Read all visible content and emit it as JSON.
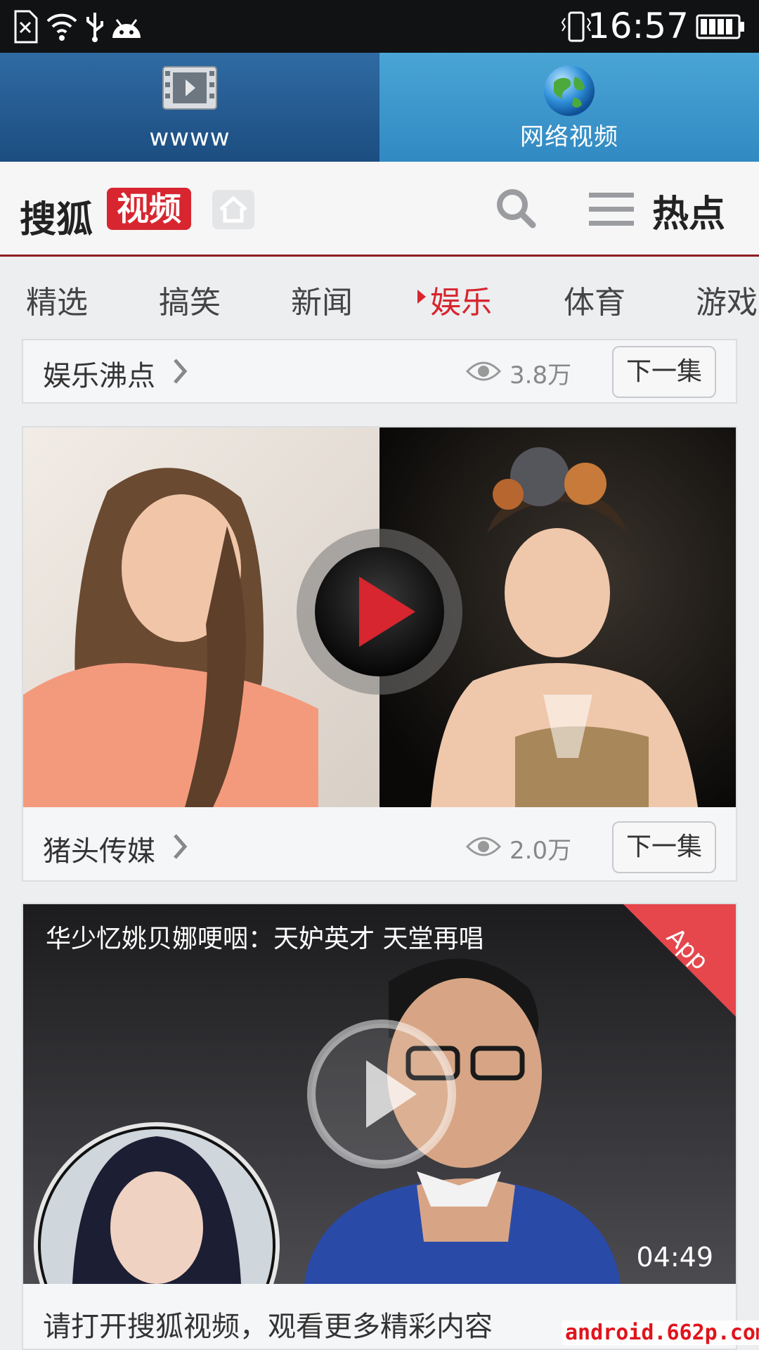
{
  "status_bar": {
    "time": "16:57"
  },
  "top_tabs": [
    {
      "label": "wwww",
      "icon": "film-icon"
    },
    {
      "label": "网络视频",
      "icon": "globe-icon"
    }
  ],
  "header": {
    "logo_text": "搜狐",
    "logo_badge": "视频",
    "hot_label": "热点",
    "brand_color": "#d7262f"
  },
  "categories": [
    "精选",
    "搞笑",
    "新闻",
    "娱乐",
    "体育",
    "游戏"
  ],
  "active_category": "娱乐",
  "cards": [
    {
      "source": "娱乐沸点",
      "views": "3.8万",
      "next_label": "下一集"
    },
    {
      "source": "猪头传媒",
      "views": "2.0万",
      "next_label": "下一集"
    },
    {
      "title": "华少忆姚贝娜哽咽：天妒英才 天堂再唱",
      "ribbon": "App",
      "duration": "04:49",
      "prompt": "请打开搜狐视频，观看更多精彩内容"
    }
  ],
  "watermark": "android.662p.com"
}
